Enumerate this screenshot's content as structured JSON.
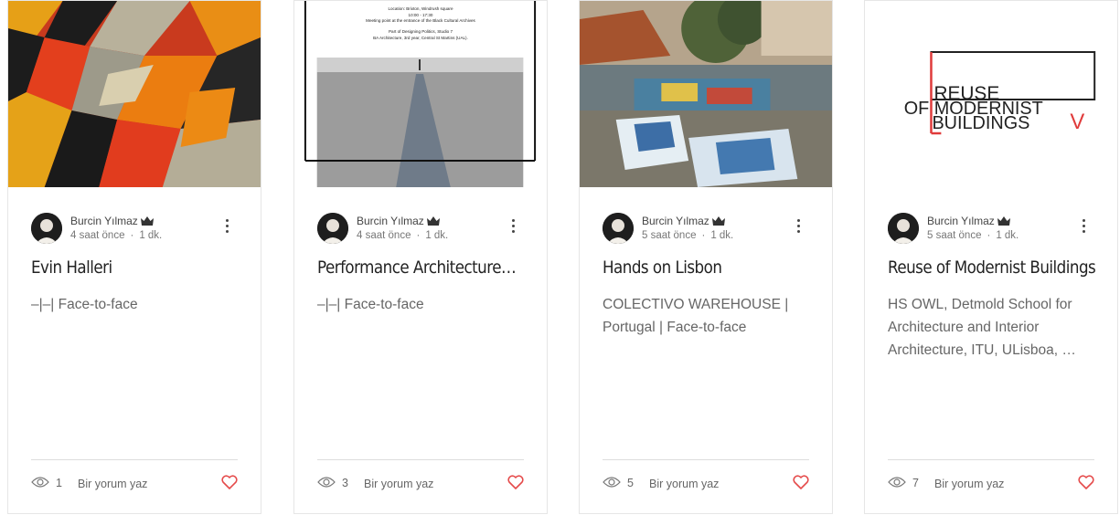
{
  "posts": [
    {
      "author": "Burcin Yılmaz",
      "time": "4 saat önce",
      "read_time": "1 dk.",
      "title": "Evin Halleri",
      "excerpt": "–|–| Face-to-face",
      "views": "1",
      "comment_label": "Bir yorum yaz"
    },
    {
      "author": "Burcin Yılmaz",
      "time": "4 saat önce",
      "read_time": "1 dk.",
      "title": "Performance Architecture…",
      "excerpt": "–|–| Face-to-face",
      "views": "3",
      "comment_label": "Bir yorum yaz",
      "image_text": {
        "line1": "Location: Brixton, Windrush square",
        "line2": "10:00 - 17:30",
        "line3": "Meeting point at the entrance of the Black Cultural Archives",
        "line4": "Part of Designing Politics, Studio 7",
        "line5": "BA Architecture, 3rd year, Central St Martins (UAL)."
      }
    },
    {
      "author": "Burcin Yılmaz",
      "time": "5 saat önce",
      "read_time": "1 dk.",
      "title": "Hands on Lisbon",
      "excerpt": "COLECTIVO WAREHOUSE | Portugal | Face-to-face",
      "views": "5",
      "comment_label": "Bir yorum yaz"
    },
    {
      "author": "Burcin Yılmaz",
      "time": "5 saat önce",
      "read_time": "1 dk.",
      "title": "Reuse of Modernist Buildings",
      "excerpt": "HS OWL, Detmold School for Architecture and Interior Architecture, ITU, ULisboa, …",
      "views": "7",
      "comment_label": "Bir yorum yaz",
      "logo_text": {
        "line1": "REUSE",
        "line2": "OF MODERNIST",
        "line3": "BUILDINGS",
        "roman": "V"
      }
    }
  ],
  "icons": {
    "more": "more-vertical-icon",
    "crown": "crown-icon",
    "eye": "eye-icon",
    "heart": "heart-icon"
  },
  "colors": {
    "heart": "#e54b4b",
    "divider": "#dddddd",
    "logo_red": "#e03b3b"
  }
}
